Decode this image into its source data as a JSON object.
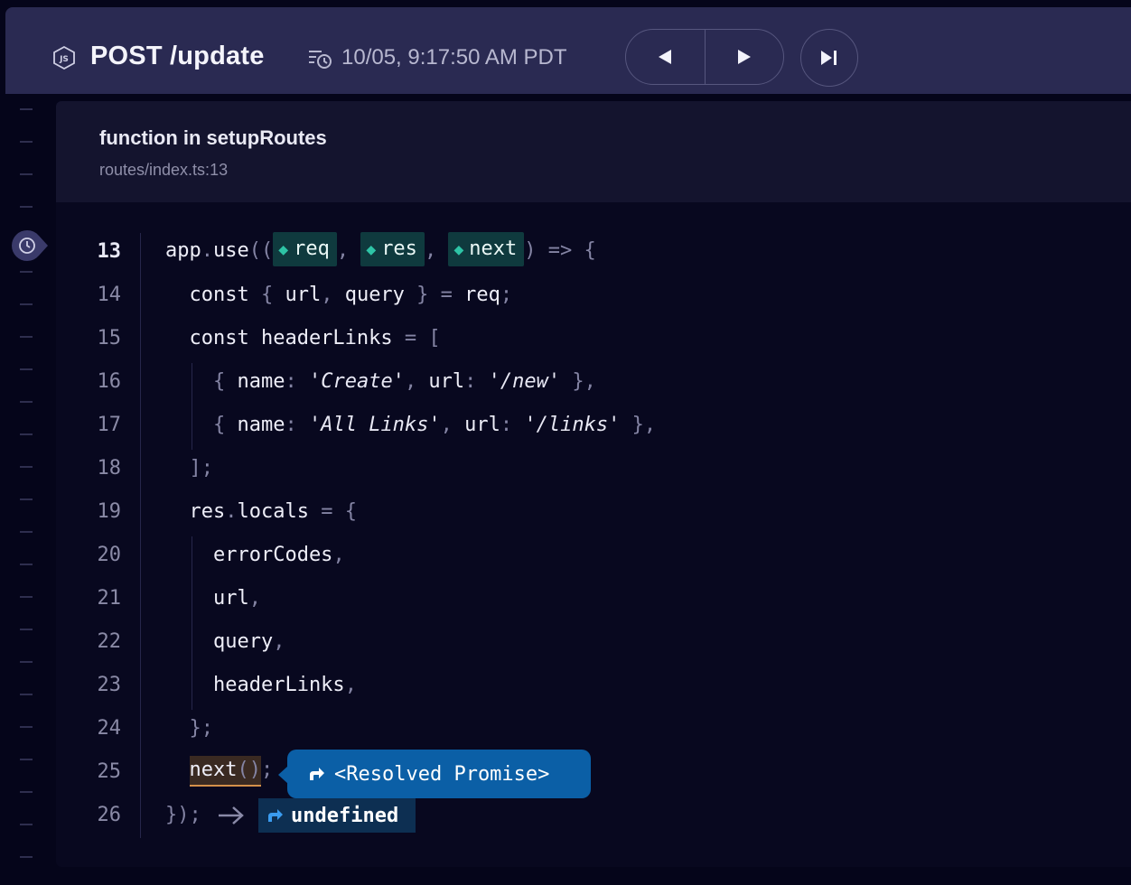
{
  "header": {
    "route": "POST /update",
    "timestamp": "10/05, 9:17:50 AM PDT",
    "runtime_icon": "nodejs-icon",
    "timestamp_icon": "history-clock-icon",
    "nav": {
      "prev_icon": "triangle-left-icon",
      "next_icon": "triangle-right-icon",
      "skip_icon": "skip-to-end-icon"
    }
  },
  "panel": {
    "function_title": "function in setupRoutes",
    "location": "routes/index.ts:13"
  },
  "code": {
    "active_line": 13,
    "lines": [
      {
        "n": "13"
      },
      {
        "n": "14"
      },
      {
        "n": "15"
      },
      {
        "n": "16"
      },
      {
        "n": "17"
      },
      {
        "n": "18"
      },
      {
        "n": "19"
      },
      {
        "n": "20"
      },
      {
        "n": "21"
      },
      {
        "n": "22"
      },
      {
        "n": "23"
      },
      {
        "n": "24"
      },
      {
        "n": "25"
      },
      {
        "n": "26"
      }
    ],
    "params": [
      "req",
      "res",
      "next"
    ],
    "strings": {
      "create": "'Create'",
      "new": "'/new'",
      "all_links": "'All Links'",
      "links": "'/links'"
    }
  },
  "annotations": {
    "next_call_value": "<Resolved Promise>",
    "return_value": "undefined"
  },
  "colors": {
    "accent_param": "#2ec4a6",
    "tooltip_bg": "#0b5fa6",
    "call_underline": "#d4904a"
  }
}
